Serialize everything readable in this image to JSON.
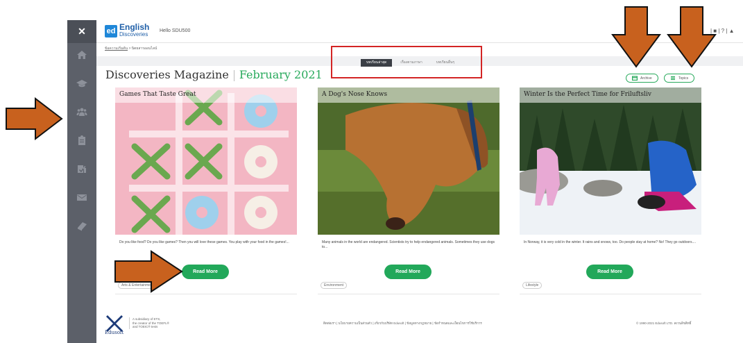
{
  "header": {
    "close_icon": "close-icon",
    "logo_mark": "ed",
    "logo_line1": "English",
    "logo_line2": "Discoveries",
    "greeting": "Hello SDU500",
    "top_right": "| ■ | ? | ▲"
  },
  "sidebar": {
    "items": [
      {
        "icon": "home-icon"
      },
      {
        "icon": "graduation-cap-icon"
      },
      {
        "icon": "community-icon"
      },
      {
        "icon": "clipboard-icon"
      },
      {
        "icon": "assessment-icon"
      },
      {
        "icon": "mail-icon"
      },
      {
        "icon": "book-icon"
      }
    ]
  },
  "breadcrumb": {
    "link": "ข้อความเริ่มต้น",
    "separator": ">",
    "current": "นิตยสารออนไลน์"
  },
  "tabs": [
    {
      "label": "บทเรียนล่าสุด",
      "active": true
    },
    {
      "label": "เรื่องตามภาษา",
      "active": false
    },
    {
      "label": "บทเรียนอื่นๆ",
      "active": false
    }
  ],
  "magazine": {
    "title": "Discoveries Magazine",
    "date": "February 2021",
    "archive_label": "Archive",
    "topics_label": "Topics"
  },
  "cards": [
    {
      "title": "Games That Taste Great",
      "description": "Do you like food? Do you like games? Then you will love these games. You play with your food in the games!...",
      "button": "Read More",
      "tag": "Arts & Entertainment"
    },
    {
      "title": "A Dog's Nose Knows",
      "description": "Many animals in the world are endangered. Scientists try to help endangered animals. Sometimes they use dogs to...",
      "button": "Read More",
      "tag": "Environment"
    },
    {
      "title": "Winter Is the Perfect Time for Friluftsliv",
      "description": "In Norway, it is very cold in the winter. It rains and snows, too. Do people stay at home? No! They go outdoors....",
      "button": "Read More",
      "tag": "Lifestyle"
    }
  ],
  "footer": {
    "logo_text": "Edusoft",
    "subsidiary_line1": "A subsidiary of ETS,",
    "subsidiary_line2": "the creator of the TOEFL®",
    "subsidiary_line3": "and TOEIC® tests",
    "links": "ติดต่อเรา | นโยบายความเป็นส่วนตัว | เกี่ยวกับบริษัท Edusoft | ข้อมูลทางกฎหมาย | ข้อกำหนดและเงื่อนไขการใช้บริการ",
    "copyright": "© 1990-2021 Edusoft LTD. สงวนลิขสิทธิ์"
  },
  "colors": {
    "accent_green": "#22a85a",
    "sidebar": "#5c6069",
    "annotation_orange": "#c8611e",
    "annotation_red": "#d32424"
  }
}
